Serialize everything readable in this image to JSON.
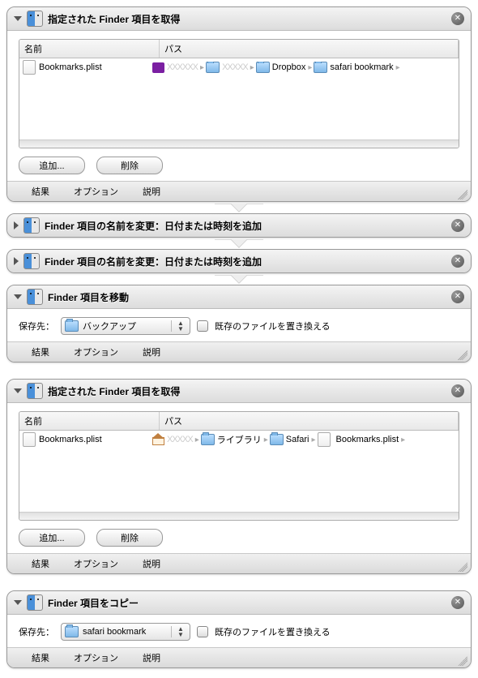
{
  "common": {
    "close_glyph": "✕",
    "chevron": "▸",
    "footer": {
      "results": "結果",
      "options": "オプション",
      "description": "説明"
    },
    "buttons": {
      "add": "追加...",
      "remove": "削除"
    },
    "columns": {
      "name": "名前",
      "path": "パス"
    },
    "dest_label": "保存先：",
    "replace_label": "既存のファイルを置き換える"
  },
  "actions": [
    {
      "kind": "get-items",
      "title": "指定された Finder 項目を取得",
      "expanded": true,
      "rows": [
        {
          "name": "Bookmarks.plist",
          "path": [
            {
              "icon": "yahoo",
              "label_blur": true,
              "label": "XXXXXX"
            },
            {
              "icon": "folder",
              "label_blur": true,
              "label": "XXXXX"
            },
            {
              "icon": "folder",
              "label": "Dropbox"
            },
            {
              "icon": "folder",
              "label": "safari bookmark"
            }
          ]
        }
      ]
    },
    {
      "kind": "rename",
      "title": "Finder 項目の名前を変更：日付または時刻を追加",
      "expanded": false
    },
    {
      "kind": "rename",
      "title": "Finder 項目の名前を変更：日付または時刻を追加",
      "expanded": false
    },
    {
      "kind": "move",
      "title": "Finder 項目を移動",
      "expanded": true,
      "dest": "バックアップ"
    },
    {
      "kind": "get-items",
      "title": "指定された Finder 項目を取得",
      "expanded": true,
      "rows": [
        {
          "name": "Bookmarks.plist",
          "path": [
            {
              "icon": "home",
              "label_blur": true,
              "label": "XXXXX"
            },
            {
              "icon": "folder",
              "label": "ライブラリ"
            },
            {
              "icon": "folder",
              "label": "Safari"
            },
            {
              "icon": "doc",
              "label": "Bookmarks.plist"
            }
          ]
        }
      ]
    },
    {
      "kind": "copy",
      "title": "Finder 項目をコピー",
      "expanded": true,
      "dest": "safari bookmark"
    }
  ]
}
